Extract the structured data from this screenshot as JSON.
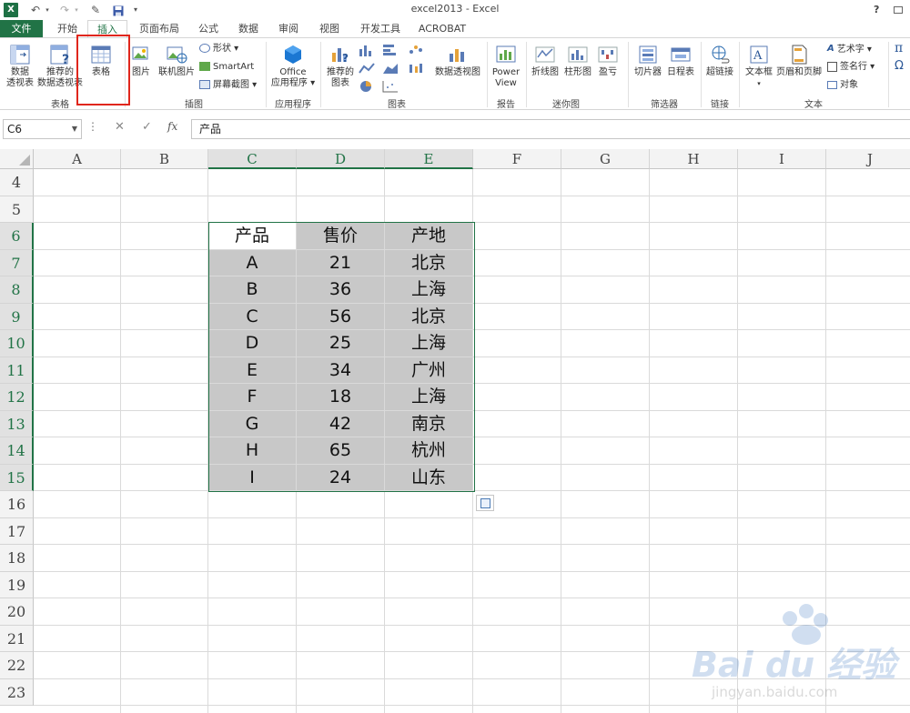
{
  "window": {
    "title": "excel2013 - Excel",
    "app_icon": "X",
    "help": "?"
  },
  "tabs": [
    {
      "label": "文件"
    },
    {
      "label": "开始"
    },
    {
      "label": "插入"
    },
    {
      "label": "页面布局"
    },
    {
      "label": "公式"
    },
    {
      "label": "数据"
    },
    {
      "label": "审阅"
    },
    {
      "label": "视图"
    },
    {
      "label": "开发工具"
    },
    {
      "label": "ACROBAT"
    }
  ],
  "ribbon": {
    "pivot_line1": "数据",
    "pivot_line2": "透视表",
    "rec_pivot_line1": "推荐的",
    "rec_pivot_line2": "数据透视表",
    "table": "表格",
    "group_tables": "表格",
    "picture": "图片",
    "online_picture": "联机图片",
    "shapes": "形状 ▾",
    "smartart": "SmartArt",
    "screenshot": "屏幕截图 ▾",
    "group_illustrations": "插图",
    "office_line1": "Office",
    "office_line2": "应用程序 ▾",
    "group_apps": "应用程序",
    "rec_chart_line1": "推荐的",
    "rec_chart_line2": "图表",
    "pivot_chart": "数据透视图",
    "group_charts": "图表",
    "power_view_line1": "Power",
    "power_view_line2": "View",
    "group_reports": "报告",
    "spark_line": "折线图",
    "spark_column": "柱形图",
    "spark_winloss": "盈亏",
    "group_sparklines": "迷你图",
    "slicer": "切片器",
    "timeline": "日程表",
    "group_filters": "筛选器",
    "hyperlink": "超链接",
    "group_links": "链接",
    "textbox": "文本框",
    "header_footer": "页眉和页脚",
    "wordart": "艺术字 ▾",
    "signature": "签名行 ▾",
    "object": "对象",
    "group_text": "文本",
    "pi": "π",
    "omega": "Ω"
  },
  "formula_bar": {
    "name_box": "C6",
    "dots": "⋮",
    "cancel": "✕",
    "enter": "✓",
    "fx": "fx",
    "content": "产品"
  },
  "columns": [
    "A",
    "B",
    "C",
    "D",
    "E",
    "F",
    "G",
    "H",
    "I",
    "J"
  ],
  "rows": [
    "4",
    "5",
    "6",
    "7",
    "8",
    "9",
    "10",
    "11",
    "12",
    "13",
    "14",
    "15",
    "16",
    "17",
    "18",
    "19",
    "20",
    "21",
    "22",
    "23"
  ],
  "table": {
    "headers": [
      "产品",
      "售价",
      "产地"
    ],
    "rows": [
      [
        "A",
        "21",
        "北京"
      ],
      [
        "B",
        "36",
        "上海"
      ],
      [
        "C",
        "56",
        "北京"
      ],
      [
        "D",
        "25",
        "上海"
      ],
      [
        "E",
        "34",
        "广州"
      ],
      [
        "F",
        "18",
        "上海"
      ],
      [
        "G",
        "42",
        "南京"
      ],
      [
        "H",
        "65",
        "杭州"
      ],
      [
        "I",
        "24",
        "山东"
      ]
    ]
  },
  "watermark": {
    "logo_text": "Bai du 经验",
    "url": "jingyan.baidu.com"
  },
  "colors": {
    "excel_green": "#217346",
    "highlight_red": "#e0261c",
    "table_fill": "#c8c8c8"
  }
}
